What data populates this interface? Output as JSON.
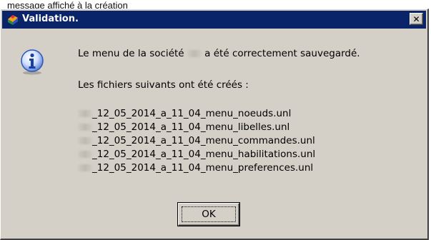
{
  "page_caption": "message affiché à la création",
  "dialog": {
    "title": "Validation.",
    "close_label": "✕",
    "message": {
      "before_company": "Le menu de la société ",
      "after_company": " a été correctement sauvegardé."
    },
    "files_intro": "Les fichiers suivants ont été créés :",
    "files": [
      "_12_05_2014_a_11_04_menu_noeuds.unl",
      "_12_05_2014_a_11_04_menu_libelles.unl",
      "_12_05_2014_a_11_04_menu_commandes.unl",
      "_12_05_2014_a_11_04_menu_habilitations.unl",
      "_12_05_2014_a_11_04_menu_preferences.unl"
    ],
    "ok_label": "OK"
  },
  "icons": {
    "app": "app-icon",
    "info": "info-icon",
    "close": "close-icon"
  },
  "colors": {
    "titlebar": "#0a246a",
    "window_face": "#d4d0c8"
  }
}
